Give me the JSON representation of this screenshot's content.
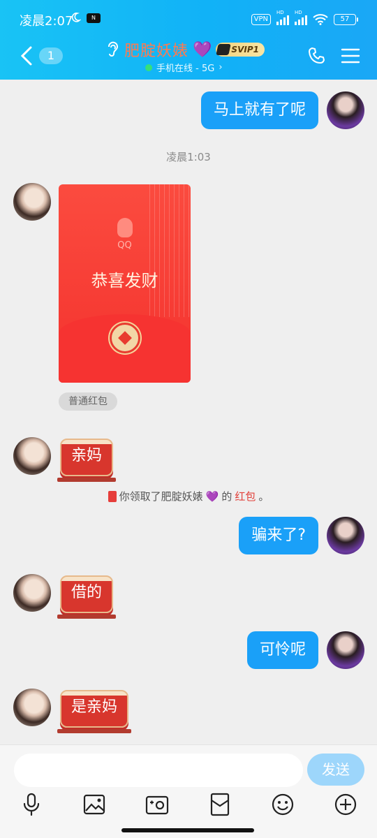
{
  "status_bar": {
    "time": "凌晨2:07",
    "vpn": "VPN",
    "hd1": "HD",
    "hd2": "HD",
    "battery": "57"
  },
  "header": {
    "unread_count": "1",
    "contact_name": "肥腚妖婊",
    "heart_emoji": "💜",
    "vip_badge": "SVIP1",
    "online_status": "手机在线 - 5G",
    "chevron": "›"
  },
  "messages": {
    "m1": {
      "sender": "me",
      "text": "马上就有了呢"
    },
    "time_separator": "凌晨1:03",
    "red_packet": {
      "logo_text": "QQ",
      "greeting": "恭喜发财",
      "type_label": "普通红包"
    },
    "m2": {
      "sender": "them",
      "text": "亲妈"
    },
    "system": {
      "prefix": "你领取了肥腚妖婊",
      "heart": "💜",
      "middle": "的",
      "highlight": "红包",
      "suffix": "。"
    },
    "m3": {
      "sender": "me",
      "text": "骗来了?"
    },
    "m4": {
      "sender": "them",
      "text": "借的"
    },
    "m5": {
      "sender": "me",
      "text": "可怜呢"
    },
    "m6": {
      "sender": "them",
      "text": "是亲妈"
    }
  },
  "input": {
    "placeholder": "",
    "send_label": "发送"
  },
  "colors": {
    "header_gradient_start": "#19c3f5",
    "header_gradient_end": "#1aa7f6",
    "my_bubble": "#1aa0f8",
    "red_packet": "#f63a33",
    "send_button_disabled": "#9dd6fb"
  }
}
